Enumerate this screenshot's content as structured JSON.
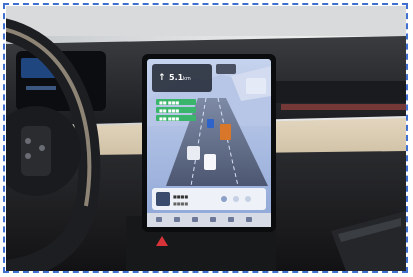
{
  "photo": {
    "description_free": true,
    "screen": {
      "nav_distance": "5.1",
      "nav_distance_unit": "km",
      "lane_badges": [
        "■■ ■■■",
        "■■ ■■■",
        "■■ ■■■"
      ],
      "media_title": "■■■■",
      "media_subtitle": "■■■■"
    },
    "colors": {
      "frame_dash": "#3f6fcf",
      "dash_beige": "#d9cbb3",
      "screen_sky": "#9fb6e0",
      "nav_green": "#3bb56b",
      "car_orange": "#d8772a",
      "car_blue": "#2e64c9"
    }
  }
}
